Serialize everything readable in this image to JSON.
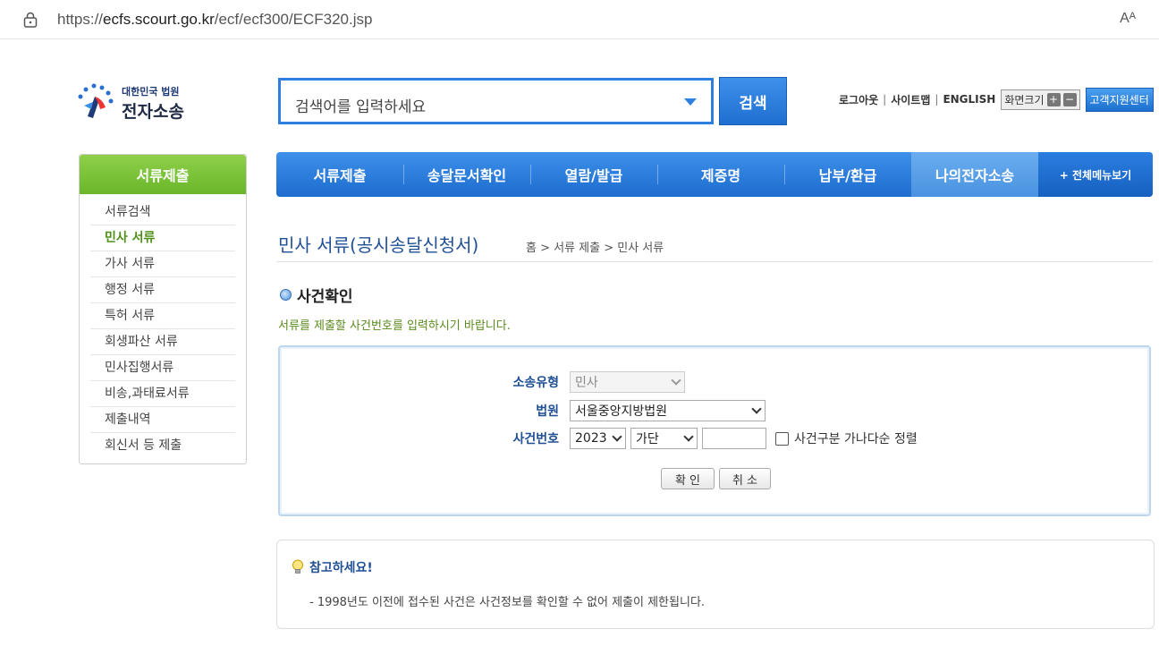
{
  "browser": {
    "url_prefix": "https://",
    "url_host": "ecfs.scourt.go.kr",
    "url_path": "/ecf/ecf300/ECF320.jsp",
    "reader_label": "Aᴬ"
  },
  "header": {
    "logo_sub": "대한민국 법원",
    "logo_main": "전자소송",
    "search_placeholder": "검색어를 입력하세요",
    "search_button": "검색",
    "util": {
      "logout": "로그아웃",
      "sitemap": "사이트맵",
      "english": "ENGLISH",
      "screen_size": "화면크기",
      "plus": "+",
      "minus": "−",
      "support": "고객지원센터"
    }
  },
  "nav": {
    "items": [
      "서류제출",
      "송달문서확인",
      "열람/발급",
      "제증명",
      "납부/환급",
      "나의전자소송"
    ],
    "all_menu": "+ 전체메뉴보기"
  },
  "sidebar": {
    "title": "서류제출",
    "items": [
      "서류검색",
      "민사 서류",
      "가사 서류",
      "행정 서류",
      "특허 서류",
      "회생파산 서류",
      "민사집행서류",
      "비송,과태료서류",
      "제출내역",
      "회신서 등 제출"
    ]
  },
  "page": {
    "title": "민사 서류(공시송달신청서)",
    "breadcrumb": "홈 > 서류 제출 > 민사 서류",
    "section_title": "사건확인",
    "description": "서류를 제출할 사건번호를 입력하시기 바랍니다."
  },
  "form": {
    "label_type": "소송유형",
    "type_value": "민사",
    "label_court": "법원",
    "court_value": "서울중앙지방법원",
    "label_case": "사건번호",
    "year_value": "2023",
    "category_value": "가단",
    "number_value": "",
    "checkbox_label": "사건구분 가나다순 정렬",
    "confirm_button": "확 인",
    "cancel_button": "취 소"
  },
  "notice": {
    "title": "참고하세요!",
    "body": "- 1998년도 이전에 접수된 사건은 사건정보를 확인할 수 없어 제출이 제한됩니다."
  }
}
